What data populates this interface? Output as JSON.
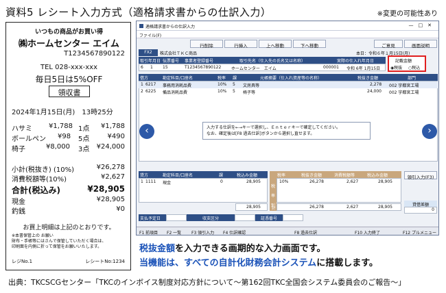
{
  "header": {
    "title": "資料5 レシート入力方式（適格請求書からの仕訳入力）",
    "note": "※変更の可能性あり"
  },
  "receipt": {
    "tagline": "いつもの商品がお買い得",
    "store": "㈱ホームセンター エイム",
    "reg_no": "T1234567890122",
    "tel": "TEL 028-xxx-xxx",
    "promo": "毎日5日は5%OFF",
    "doc_title": "領収書",
    "date": "2024年1月15日(月)　13時25分",
    "items": [
      {
        "name": "ハサミ",
        "price": "¥1,788",
        "qty": "1点",
        "amount": "¥1,788"
      },
      {
        "name": "ボールペン",
        "price": "¥98",
        "qty": "5点",
        "amount": "¥490"
      },
      {
        "name": "椅子",
        "price": "¥8,000",
        "qty": "3点",
        "amount": "¥24,000"
      }
    ],
    "subtotal_label": "小計(税抜き) (10%)",
    "subtotal": "¥26,278",
    "tax_label": "消費税額等(10%)",
    "tax": "¥2,627",
    "total_label": "合計(税込み)",
    "total": "¥28,905",
    "cash_label": "現金",
    "cash": "¥28,905",
    "change_label": "釣銭",
    "change": "¥0",
    "footer": "お買上明細は上記のとおりです。",
    "notes": "※本書保管上の お願い\n財布・手帳等にはさんで保管していただく場合は、\n印刷面を内側に折って保管をお願いいたします。",
    "register": "レジNo.1",
    "receipt_no": "レシートNo:1234"
  },
  "window": {
    "title": "適格請求書からの仕訳入力",
    "menu": "ファイル(F)",
    "toolbar": [
      "行削除",
      "行挿入",
      "上へ移動",
      "下へ移動",
      "ご意見",
      "画面説明"
    ],
    "fx2": "FX2",
    "company": "株式会社ＴＫＣ商品",
    "period": "本日：令和６年１月15日(月)",
    "head_cols": [
      "取引年月日",
      "伝票番号",
      "事業者登録番号",
      "取引先名（仕入先の氏名又は名称）",
      "実際の仕入れ年月日"
    ],
    "head_vals": [
      "6",
      "1",
      "15",
      "T1234567890122",
      "ホームセンター　エイム",
      "000001",
      "令和 6年 1月15日"
    ],
    "mode_label": "記載金額",
    "mode_opts": [
      "税抜",
      "税込"
    ],
    "line_cols": [
      "借方",
      "勘定科目/口座名",
      "税率",
      "課",
      "元帳摘要（仕入れ資産等の名称）",
      "税抜き金額",
      "部門"
    ],
    "lines": [
      {
        "no": "1",
        "code": "6217",
        "acct": "事務用消耗品費",
        "rate": "10%",
        "k": "5",
        "memo": "文房具等",
        "amt": "2,278",
        "dept": "002 宇都宮工場"
      },
      {
        "no": "2",
        "code": "6225",
        "acct": "備品消耗品費",
        "rate": "10%",
        "k": "5",
        "memo": "椅子等",
        "amt": "24,000",
        "dept": "002 宇都宮工場"
      }
    ],
    "message": "入力する仕訳を←→キーで選択し、Ｅｎｔｅｒキーで確定してください。\nなお、確定後は[F8 過去仕訳]ボタンから選択し直せます。",
    "credit_cols": [
      "貸方",
      "勘定科目/口座名",
      "課",
      "税込み金額"
    ],
    "credit_line": {
      "no": "1",
      "code": "1111",
      "acct": "現金",
      "k": "0",
      "amt": "28,905"
    },
    "credit_total": "28,905",
    "sum_cols": [
      "税率",
      "税抜き金額",
      "消費税額等",
      "税込み金額"
    ],
    "sum_side": "税率別",
    "sum_row": {
      "rate": "10%",
      "ex": "26,278",
      "tax": "2,627",
      "inc": "28,905"
    },
    "sum_total_label": "計",
    "sum_total": {
      "ex": "26,278",
      "tax": "2,627",
      "inc": "28,905"
    },
    "f3_label": "領引入力(F3)",
    "diff_label": "貸借差額",
    "diff_value": "0",
    "pay_label": "支払予定日",
    "pay2_label": "収支区分",
    "voucher_label": "証憑番号",
    "fkeys": [
      "F1 前項目",
      "F2 一覧",
      "F3 領引入力",
      "F4 仕訳確認",
      "F8 過去仕訳",
      "F10 入力終了",
      "F12 プルメニュー"
    ]
  },
  "caption": {
    "line1_pre": "税抜金額",
    "line1_post": "を入力できる画期的な入力画面です。",
    "line2_pre": "当機能は、すべての自計化財務会計システム",
    "line2_post": "に搭載します。"
  },
  "source": "出典：TKCSCGセンター「TKCのインボイス制度対応方針について～第162回TKC全国会システム委員会のご報告～」",
  "colors": {
    "accent_blue": "#1a52b8",
    "window_blue": "#2e4f86",
    "highlight_red": "#e01e1e",
    "orange": "#c9a77d"
  }
}
